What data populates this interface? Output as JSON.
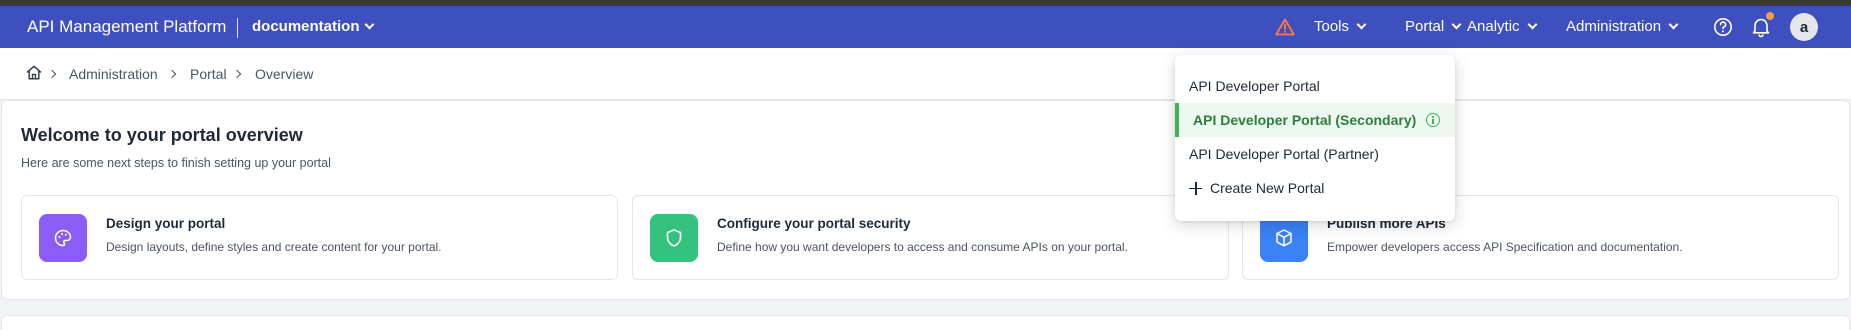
{
  "header": {
    "app_title": "API Management Platform",
    "project": "documentation",
    "nav": {
      "tools": "Tools",
      "portal": "Portal",
      "analytic": "Analytic",
      "administration": "Administration"
    },
    "avatar_initial": "a",
    "notification_dot_color": "#f59e42"
  },
  "breadcrumb": {
    "items": [
      "Administration",
      "Portal",
      "Overview"
    ]
  },
  "welcome": {
    "title": "Welcome to your portal overview",
    "subtitle": "Here are some next steps to finish setting up your portal"
  },
  "steps": [
    {
      "title": "Design your portal",
      "description": "Design layouts, define styles and create content for your portal.",
      "icon": "palette-icon",
      "color": "#8b5cf6"
    },
    {
      "title": "Configure your portal security",
      "description": "Define how you want developers to access and consume APIs on your portal.",
      "icon": "shield-icon",
      "color": "#34c17e"
    },
    {
      "title": "Publish more APIs",
      "description": "Empower developers access API Specification and documentation.",
      "icon": "cube-icon",
      "color": "#3b82f6"
    }
  ],
  "portal_menu": {
    "items": [
      "API Developer Portal",
      "API Developer Portal (Secondary)",
      "API Developer Portal (Partner)"
    ],
    "active_index": 1,
    "create_label": "Create New Portal"
  }
}
